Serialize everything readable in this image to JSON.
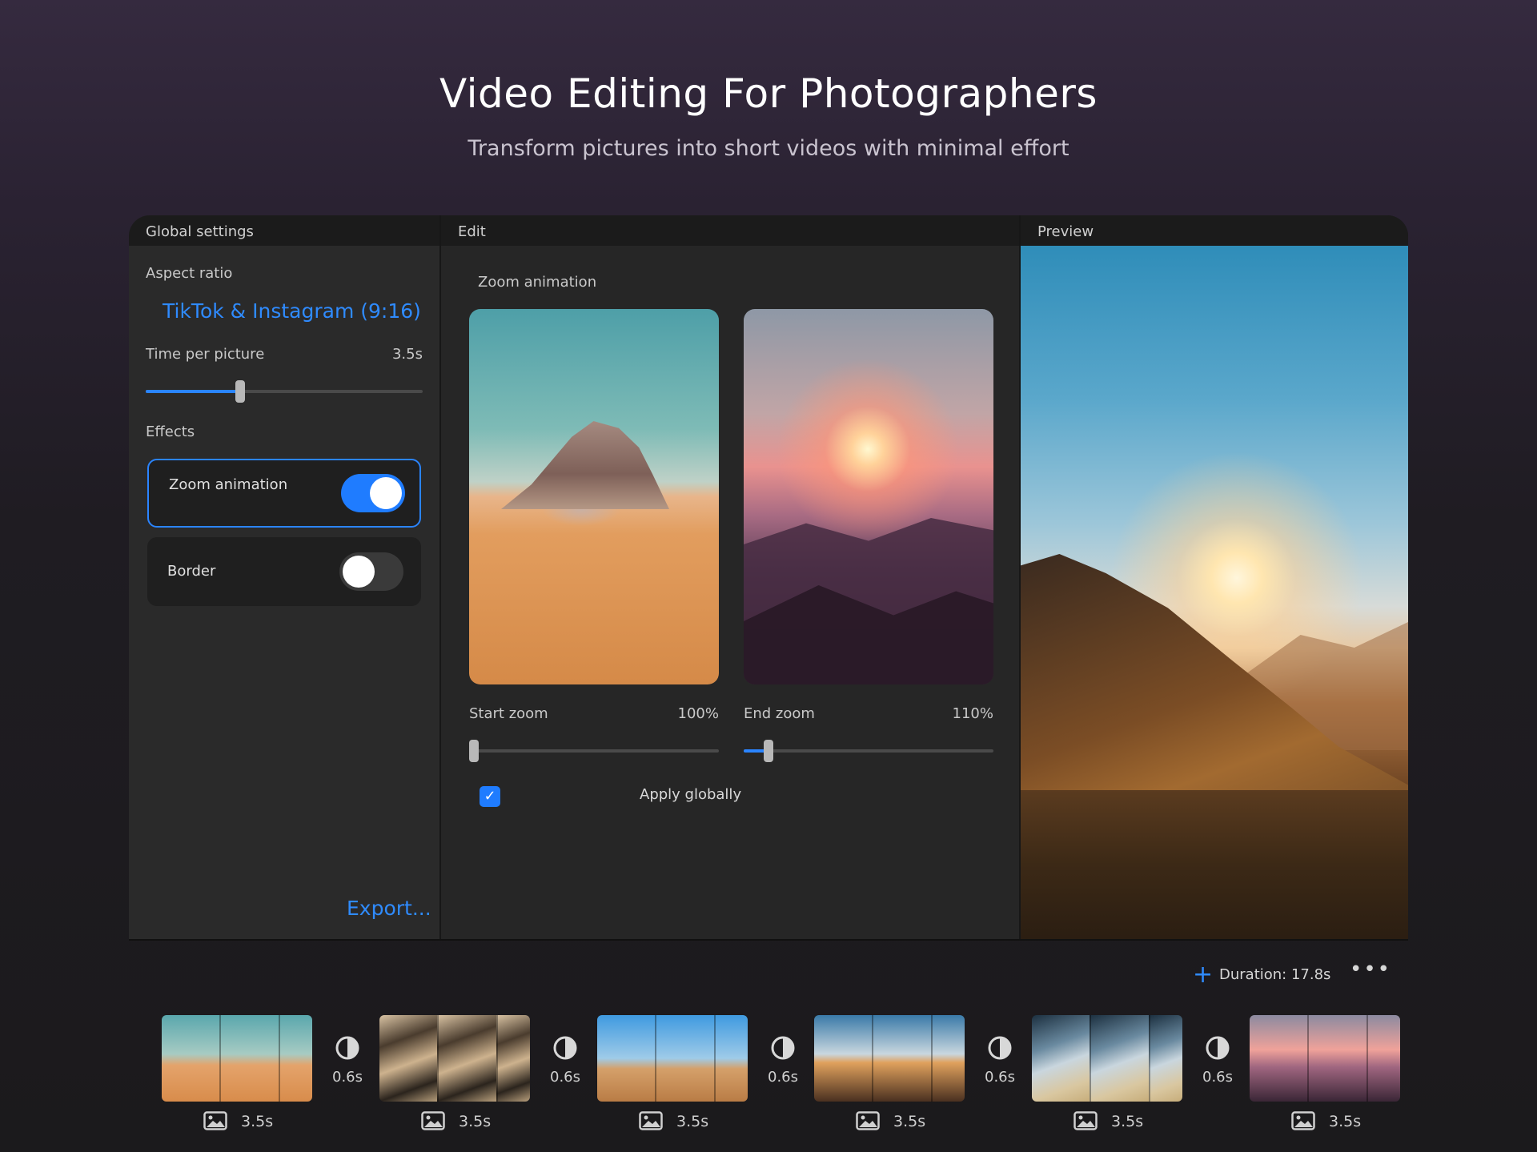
{
  "hero": {
    "title": "Video Editing For Photographers",
    "subtitle": "Transform pictures into short videos with minimal effort"
  },
  "global_settings": {
    "header": "Global settings",
    "aspect_ratio_label": "Aspect ratio",
    "aspect_ratio_value": "TikTok & Instagram (9:16)",
    "time_per_picture_label": "Time per picture",
    "time_per_picture_value": "3.5s",
    "time_per_picture_slider_fraction": 0.34,
    "effects_label": "Effects",
    "effects": [
      {
        "label": "Zoom animation",
        "enabled": true
      },
      {
        "label": "Border",
        "enabled": false
      }
    ],
    "export_label": "Export..."
  },
  "edit": {
    "header": "Edit",
    "section_title": "Zoom animation",
    "start_zoom_label": "Start zoom",
    "start_zoom_value": "100%",
    "start_zoom_fraction": 0.0,
    "end_zoom_label": "End zoom",
    "end_zoom_value": "110%",
    "end_zoom_fraction": 0.1,
    "apply_globally_label": "Apply globally",
    "apply_globally_checked": true
  },
  "preview": {
    "header": "Preview"
  },
  "timeline": {
    "duration_label": "Duration: 17.8s",
    "add_icon": "plus-icon",
    "more_icon": "more-icon",
    "clips": [
      {
        "duration": "3.5s"
      },
      {
        "duration": "3.5s"
      },
      {
        "duration": "3.5s"
      },
      {
        "duration": "3.5s"
      },
      {
        "duration": "3.5s"
      },
      {
        "duration": "3.5s"
      }
    ],
    "transitions": [
      {
        "duration": "0.6s"
      },
      {
        "duration": "0.6s"
      },
      {
        "duration": "0.6s"
      },
      {
        "duration": "0.6s"
      },
      {
        "duration": "0.6s"
      }
    ]
  },
  "colors": {
    "accent": "#2a84ff",
    "panel": "#2a2a2a",
    "header": "#1b1b1b"
  }
}
